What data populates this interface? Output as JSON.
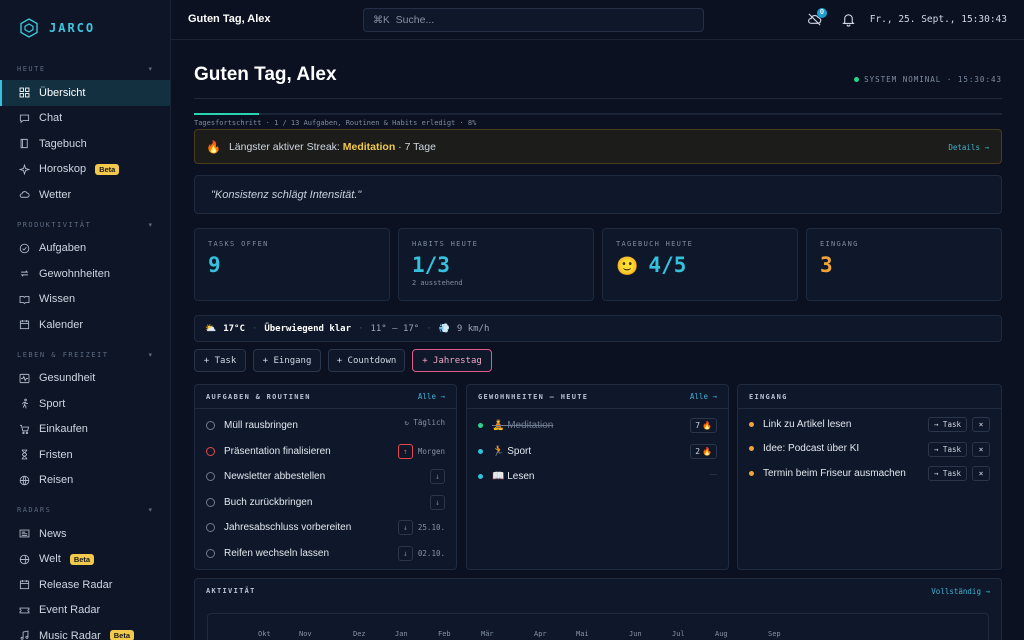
{
  "brand": {
    "name": "JARCO"
  },
  "sidebar": {
    "sections": [
      {
        "label": "HEUTE",
        "items": [
          {
            "label": "Übersicht",
            "icon": "grid-icon",
            "active": true
          },
          {
            "label": "Chat",
            "icon": "chat-icon"
          },
          {
            "label": "Tagebuch",
            "icon": "book-icon"
          },
          {
            "label": "Horoskop",
            "icon": "sparkle-icon",
            "badge": "Beta"
          },
          {
            "label": "Wetter",
            "icon": "cloud-icon"
          }
        ]
      },
      {
        "label": "PRODUKTIVITÄT",
        "items": [
          {
            "label": "Aufgaben",
            "icon": "check-circle-icon"
          },
          {
            "label": "Gewohnheiten",
            "icon": "repeat-icon"
          },
          {
            "label": "Wissen",
            "icon": "open-book-icon"
          },
          {
            "label": "Kalender",
            "icon": "calendar-icon"
          }
        ]
      },
      {
        "label": "LEBEN & FREIZEIT",
        "items": [
          {
            "label": "Gesundheit",
            "icon": "pulse-icon"
          },
          {
            "label": "Sport",
            "icon": "runner-icon"
          },
          {
            "label": "Einkaufen",
            "icon": "cart-icon"
          },
          {
            "label": "Fristen",
            "icon": "hourglass-icon"
          },
          {
            "label": "Reisen",
            "icon": "globe-pin-icon"
          }
        ]
      },
      {
        "label": "RADARS",
        "items": [
          {
            "label": "News",
            "icon": "newspaper-icon"
          },
          {
            "label": "Welt",
            "icon": "globe-icon",
            "badge": "Beta"
          },
          {
            "label": "Release Radar",
            "icon": "calendar-icon"
          },
          {
            "label": "Event Radar",
            "icon": "ticket-icon"
          },
          {
            "label": "Music Radar",
            "icon": "music-icon",
            "badge": "Beta"
          }
        ]
      }
    ]
  },
  "topbar": {
    "greeting": "Guten Tag, Alex",
    "search_kbd": "⌘K",
    "search_placeholder": "Suche...",
    "notif_count": "0",
    "datetime": "Fr., 25. Sept., 15:30:43"
  },
  "header": {
    "title": "Guten Tag, Alex",
    "status": "SYSTEM NOMINAL · 15:30:43",
    "progress_label": "Tagesfortschritt · 1 / 13 Aufgaben, Routinen & Habits erledigt · 8%",
    "progress_pct": 8
  },
  "streak": {
    "prefix": "Längster aktiver Streak: ",
    "habit": "Meditation",
    "suffix": " · 7 Tage",
    "link": "Details →"
  },
  "quote": "\"Konsistenz schlägt Intensität.\"",
  "stats": [
    {
      "label": "TASKS OFFEN",
      "value": "9",
      "sub": "",
      "color": "#35c0db"
    },
    {
      "label": "HABITS HEUTE",
      "value": "1/3",
      "sub": "2 ausstehend",
      "color": "#35c0db"
    },
    {
      "label": "TAGEBUCH HEUTE",
      "value": "4/5",
      "sub": "",
      "emoji": "🙂",
      "color": "#35c0db"
    },
    {
      "label": "EINGANG",
      "value": "3",
      "sub": "",
      "color": "#f2a33a"
    }
  ],
  "weather": {
    "icon": "⛅",
    "temp": "17°C",
    "condition": "Überwiegend klar",
    "range": "11° – 17°",
    "wind": "9 km/h"
  },
  "quick_actions": [
    "+ Task",
    "+ Eingang",
    "+ Countdown",
    "+ Jahrestag"
  ],
  "tasks": {
    "title": "AUFGABEN & ROUTINEN",
    "link": "Alle →",
    "items": [
      {
        "label": "Müll rausbringen",
        "meta": "↻ Täglich"
      },
      {
        "label": "Präsentation finalisieren",
        "meta": "Morgen",
        "priority": true
      },
      {
        "label": "Newsletter abbestellen",
        "meta": ""
      },
      {
        "label": "Buch zurückbringen",
        "meta": ""
      },
      {
        "label": "Jahresabschluss vorbereiten",
        "meta": "25.10."
      },
      {
        "label": "Reifen wechseln lassen",
        "meta": "02.10."
      }
    ]
  },
  "habits": {
    "title": "GEWOHNHEITEN — HEUTE",
    "link": "Alle →",
    "items": [
      {
        "label": "🧘 Meditation",
        "count": "7",
        "done": true,
        "color": "#2ad48a"
      },
      {
        "label": "🏃 Sport",
        "count": "2",
        "done": false,
        "color": "#35c0db"
      },
      {
        "label": "📖 Lesen",
        "count": "",
        "done": false,
        "color": "#35c0db"
      }
    ]
  },
  "inbox": {
    "title": "EINGANG",
    "task_label": "→ Task",
    "items": [
      {
        "label": "Link zu Artikel lesen"
      },
      {
        "label": "Idee: Podcast über KI"
      },
      {
        "label": "Termin beim Friseur ausmachen"
      }
    ]
  },
  "activity": {
    "title": "AKTIVITÄT",
    "link": "Vollständig →",
    "months": [
      "Okt",
      "Nov",
      "Dez",
      "Jan",
      "Feb",
      "Mär",
      "Apr",
      "Mai",
      "Jun",
      "Jul",
      "Aug",
      "Sep"
    ]
  }
}
